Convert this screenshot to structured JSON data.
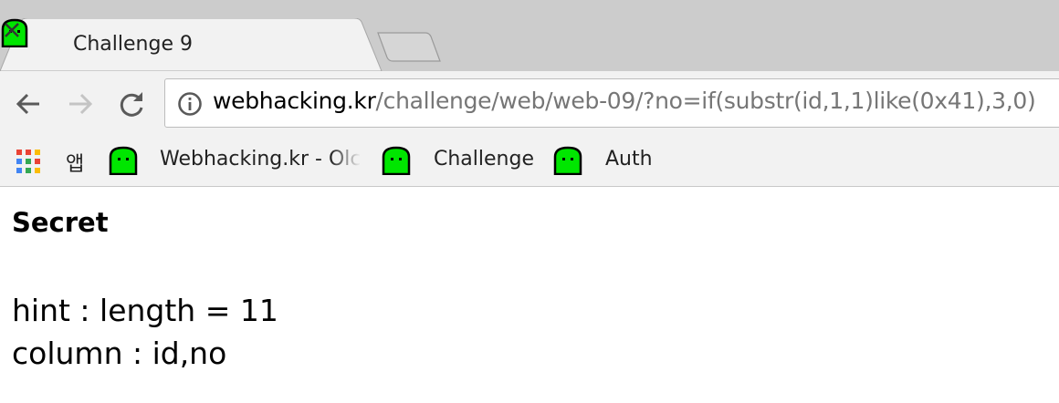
{
  "tab": {
    "title": "Challenge 9",
    "favicon": "green-ghost-icon",
    "close": "close-icon"
  },
  "toolbar": {
    "back": "back-arrow-icon",
    "forward": "forward-arrow-icon",
    "reload": "reload-icon",
    "url_host": "webhacking.kr",
    "url_path": "/challenge/web/web-09/?no=if(substr(id,1,1)like(0x41),3,0)"
  },
  "bookmarks": [
    {
      "label": "앱",
      "icon": "apps-grid-icon"
    },
    {
      "label": "Webhacking.kr - Olc",
      "icon": "green-ghost-icon"
    },
    {
      "label": "Challenge",
      "icon": "green-ghost-icon"
    },
    {
      "label": "Auth",
      "icon": "green-ghost-icon"
    }
  ],
  "page": {
    "heading": "Secret",
    "hint": "hint : length = 11",
    "column": "column : id,no"
  },
  "colors": {
    "ghost": "#00e600",
    "tabstrip": "#cccccc",
    "toolbar": "#f2f2f2",
    "url_path": "#767676"
  }
}
